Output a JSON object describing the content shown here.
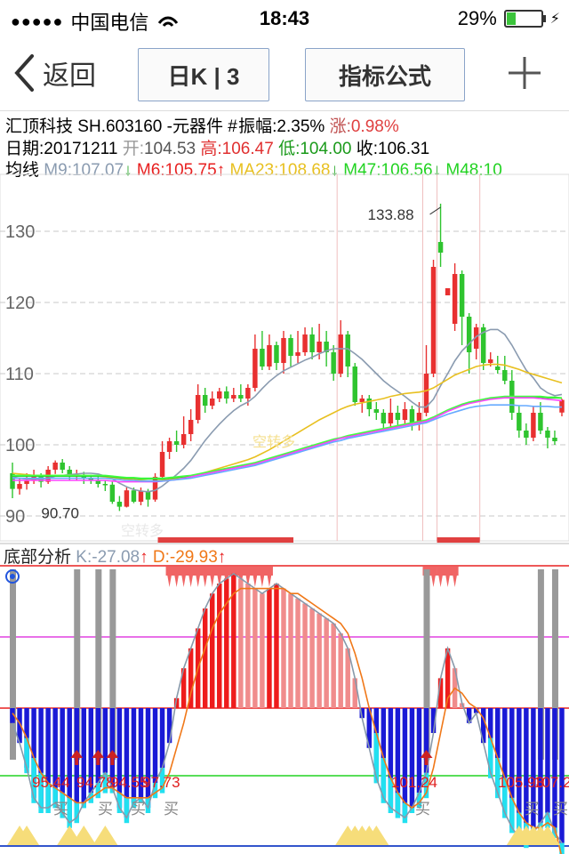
{
  "status": {
    "carrier": "中国电信",
    "time": "18:43",
    "battery_text": "29%",
    "battery_level": 0.29
  },
  "nav": {
    "back_label": "返回",
    "period_label": "日K | 3",
    "formula_label": "指标公式"
  },
  "info": {
    "name": "汇顶科技",
    "code": "SH.603160",
    "industry": "-元器件",
    "marker": "#",
    "amp_label": "振幅:",
    "amp": "2.35%",
    "chg_label": "涨:",
    "chg": "0.98%",
    "date_label": "日期:",
    "date": "20171211",
    "open_label": "开:",
    "open": "104.53",
    "high_label": "高:",
    "high": "106.47",
    "low_label": "低:",
    "low": "104.00",
    "close_label": "收:",
    "close": "106.31",
    "ma_label": "均线",
    "ma": [
      {
        "text": "M9:107.07",
        "arrow": "↓",
        "color": "#8a9bb0",
        "arrow_color": "#1aa31a"
      },
      {
        "text": "M6:105.75",
        "arrow": "↑",
        "color": "#e82020",
        "arrow_color": "#e82020"
      },
      {
        "text": "MA23:108.68",
        "arrow": "↓",
        "color": "#e8c020",
        "arrow_color": "#1aa31a"
      },
      {
        "text": "M47:106.56",
        "arrow": "↓",
        "color": "#22d322",
        "arrow_color": "#1aa31a"
      },
      {
        "text": "M48:10",
        "arrow": "",
        "color": "#22d322",
        "arrow_color": "#1aa31a"
      }
    ]
  },
  "main_chart": {
    "y_ticks": [
      "130",
      "120",
      "110",
      "100",
      "90"
    ],
    "max_label": "133.88",
    "min_label": "90.70",
    "faint_labels": [
      "空转多",
      "空转多"
    ]
  },
  "indicator": {
    "title": "底部分析",
    "k": "K:-27.08",
    "k_arrow": "↑",
    "d": "D:-29.93",
    "d_arrow": "↑",
    "value_labels": [
      "95.44",
      "94.78",
      "94.55",
      "97.73",
      "101.24",
      "105.93",
      "107.28"
    ],
    "buy_label": "买"
  },
  "chart_data": {
    "type": "candlestick",
    "ylim": [
      87,
      138
    ],
    "candles": [
      [
        96.0,
        93.8,
        97.5,
        92.5
      ],
      [
        93.8,
        94.5,
        95.2,
        93.0
      ],
      [
        94.5,
        95.0,
        96.0,
        93.7
      ],
      [
        95.0,
        95.5,
        96.5,
        94.5
      ],
      [
        95.5,
        94.8,
        96.0,
        94.0
      ],
      [
        94.8,
        96.5,
        97.0,
        94.5
      ],
      [
        96.5,
        97.5,
        97.8,
        95.9
      ],
      [
        97.5,
        96.5,
        98.0,
        96.0
      ],
      [
        96.5,
        95.6,
        97.0,
        95.0
      ],
      [
        95.6,
        95.8,
        96.5,
        95.0
      ],
      [
        95.8,
        95.3,
        96.2,
        94.5
      ],
      [
        95.3,
        95.0,
        95.8,
        94.5
      ],
      [
        95.0,
        94.5,
        95.5,
        94.0
      ],
      [
        94.5,
        94.4,
        95.0,
        93.5
      ],
      [
        94.4,
        92.0,
        94.8,
        91.7
      ],
      [
        92.0,
        91.3,
        92.8,
        90.7
      ],
      [
        91.3,
        93.6,
        94.0,
        91.2
      ],
      [
        93.6,
        92.0,
        94.0,
        91.8
      ],
      [
        92.0,
        93.5,
        94.0,
        91.5
      ],
      [
        93.5,
        92.3,
        93.8,
        91.3
      ],
      [
        92.3,
        95.5,
        96.0,
        92.0
      ],
      [
        95.5,
        99.0,
        100.5,
        95.3
      ],
      [
        99.0,
        100.5,
        101.0,
        98.0
      ],
      [
        100.5,
        100.0,
        102.0,
        99.0
      ],
      [
        100.0,
        101.5,
        104.0,
        99.5
      ],
      [
        101.5,
        103.5,
        105.0,
        100.5
      ],
      [
        103.5,
        107.0,
        108.5,
        103.0
      ],
      [
        107.0,
        105.5,
        108.0,
        104.5
      ],
      [
        105.5,
        106.5,
        107.5,
        105.0
      ],
      [
        106.5,
        107.5,
        108.0,
        106.0
      ],
      [
        107.5,
        106.5,
        108.2,
        105.8
      ],
      [
        106.5,
        107.0,
        108.0,
        106.0
      ],
      [
        107.0,
        106.5,
        108.5,
        106.0
      ],
      [
        106.5,
        108.0,
        108.5,
        105.5
      ],
      [
        108.0,
        113.5,
        115.5,
        107.5
      ],
      [
        113.5,
        111.0,
        116.0,
        110.5
      ],
      [
        111.0,
        114.0,
        115.5,
        110.5
      ],
      [
        114.0,
        111.5,
        114.5,
        110.5
      ],
      [
        111.5,
        115.0,
        116.0,
        110.0
      ],
      [
        115.0,
        112.5,
        115.5,
        111.0
      ],
      [
        112.5,
        113.0,
        116.0,
        111.5
      ],
      [
        113.0,
        115.5,
        116.5,
        112.5
      ],
      [
        115.5,
        113.0,
        116.5,
        112.0
      ],
      [
        113.0,
        114.5,
        117.0,
        112.0
      ],
      [
        114.5,
        113.0,
        116.0,
        111.0
      ],
      [
        113.0,
        110.0,
        114.0,
        109.0
      ],
      [
        110.0,
        115.5,
        117.5,
        109.5
      ],
      [
        115.5,
        111.0,
        116.0,
        109.5
      ],
      [
        111.0,
        106.0,
        111.5,
        105.5
      ],
      [
        106.0,
        106.5,
        107.0,
        104.5
      ],
      [
        106.5,
        105.0,
        107.0,
        104.0
      ],
      [
        105.0,
        104.5,
        106.0,
        103.5
      ],
      [
        104.5,
        103.0,
        105.0,
        102.0
      ],
      [
        103.0,
        104.5,
        106.5,
        102.5
      ],
      [
        104.5,
        103.5,
        105.5,
        102.5
      ],
      [
        103.5,
        105.0,
        106.0,
        103.0
      ],
      [
        105.0,
        103.0,
        105.5,
        102.0
      ],
      [
        103.0,
        104.5,
        106.0,
        102.0
      ],
      [
        104.5,
        110.0,
        114.0,
        104.0
      ],
      [
        110.0,
        125.0,
        126.0,
        109.5
      ],
      [
        128.5,
        127.0,
        133.88,
        125.0
      ],
      [
        121.0,
        122.0,
        122.0,
        121.0
      ],
      [
        117.0,
        124.0,
        125.5,
        116.0
      ],
      [
        124.0,
        118.0,
        124.5,
        114.0
      ],
      [
        118.0,
        113.0,
        118.5,
        110.0
      ],
      [
        113.5,
        116.5,
        117.0,
        112.0
      ],
      [
        116.5,
        111.5,
        117.0,
        110.5
      ],
      [
        111.5,
        112.0,
        113.0,
        111.0
      ],
      [
        111.0,
        110.5,
        112.5,
        110.0
      ],
      [
        110.5,
        109.0,
        112.5,
        108.5
      ],
      [
        109.0,
        104.5,
        110.5,
        103.5
      ],
      [
        104.5,
        102.0,
        105.5,
        101.0
      ],
      [
        102.0,
        101.0,
        103.0,
        100.0
      ],
      [
        101.0,
        104.5,
        105.5,
        100.5
      ],
      [
        104.5,
        102.0,
        106.0,
        101.5
      ],
      [
        102.0,
        101.0,
        102.5,
        99.5
      ],
      [
        101.0,
        100.5,
        102.0,
        100.0
      ],
      [
        104.53,
        106.31,
        106.47,
        104.0
      ]
    ],
    "ma": [
      {
        "name": "M9",
        "color": "#8a9bb0",
        "values": [
          95.5,
          95.3,
          95.2,
          95.2,
          95.2,
          95.3,
          95.6,
          95.7,
          95.8,
          95.9,
          96.0,
          96.0,
          95.9,
          95.6,
          95.2,
          94.6,
          94.1,
          93.7,
          93.5,
          93.4,
          93.6,
          94.2,
          95.0,
          95.8,
          96.7,
          97.8,
          99.2,
          100.6,
          101.8,
          102.9,
          103.9,
          104.8,
          105.5,
          106.0,
          106.8,
          107.9,
          108.9,
          109.7,
          110.4,
          110.9,
          111.4,
          111.9,
          112.3,
          112.8,
          113.2,
          113.5,
          113.5,
          113.5,
          112.8,
          112.0,
          111.0,
          110.0,
          109.0,
          108.2,
          107.5,
          106.8,
          106.0,
          105.3,
          105.3,
          106.4,
          108.3,
          110.0,
          111.8,
          113.2,
          114.2,
          115.2,
          115.8,
          116.2,
          116.2,
          115.5,
          114.0,
          112.2,
          110.5,
          109.4,
          108.0,
          107.3,
          106.9,
          107.07
        ]
      },
      {
        "name": "MA23",
        "color": "#e8c020",
        "values": [
          96.0,
          95.9,
          95.8,
          95.7,
          95.7,
          95.7,
          95.7,
          95.7,
          95.7,
          95.7,
          95.7,
          95.6,
          95.6,
          95.5,
          95.4,
          95.3,
          95.2,
          95.1,
          95.0,
          94.9,
          94.9,
          95.0,
          95.1,
          95.2,
          95.3,
          95.5,
          95.8,
          96.1,
          96.4,
          96.7,
          97.0,
          97.3,
          97.6,
          97.9,
          98.3,
          98.8,
          99.3,
          99.9,
          100.5,
          101.1,
          101.7,
          102.3,
          102.9,
          103.5,
          104.0,
          104.5,
          105.0,
          105.4,
          105.7,
          105.9,
          106.1,
          106.3,
          106.5,
          106.8,
          107.0,
          107.2,
          107.3,
          107.4,
          107.6,
          108.0,
          108.6,
          109.2,
          109.8,
          110.2,
          110.6,
          111.0,
          111.2,
          111.3,
          111.3,
          111.2,
          110.9,
          110.6,
          110.2,
          109.9,
          109.6,
          109.3,
          109.0,
          108.7
        ]
      },
      {
        "name": "M47",
        "color": "#22d322",
        "values": [
          95.6,
          95.6,
          95.6,
          95.6,
          95.6,
          95.6,
          95.6,
          95.6,
          95.6,
          95.6,
          95.6,
          95.6,
          95.6,
          95.6,
          95.5,
          95.4,
          95.3,
          95.3,
          95.2,
          95.2,
          95.2,
          95.2,
          95.3,
          95.4,
          95.5,
          95.6,
          95.8,
          96.0,
          96.2,
          96.4,
          96.6,
          96.8,
          97.0,
          97.2,
          97.4,
          97.7,
          98.0,
          98.3,
          98.6,
          98.9,
          99.2,
          99.5,
          99.8,
          100.1,
          100.4,
          100.7,
          100.9,
          101.2,
          101.4,
          101.6,
          101.8,
          102.0,
          102.2,
          102.4,
          102.6,
          102.8,
          103.0,
          103.2,
          103.4,
          103.8,
          104.3,
          104.8,
          105.2,
          105.6,
          105.9,
          106.1,
          106.3,
          106.5,
          106.6,
          106.7,
          106.7,
          106.7,
          106.7,
          106.7,
          106.7,
          106.6,
          106.6,
          106.56
        ]
      },
      {
        "name": "M48",
        "color": "#44ff44",
        "values": [
          95.7,
          95.7,
          95.7,
          95.7,
          95.7,
          95.7,
          95.7,
          95.7,
          95.7,
          95.7,
          95.7,
          95.7,
          95.7,
          95.7,
          95.6,
          95.5,
          95.4,
          95.4,
          95.3,
          95.3,
          95.3,
          95.3,
          95.4,
          95.5,
          95.6,
          95.7,
          95.9,
          96.1,
          96.3,
          96.5,
          96.7,
          96.9,
          97.1,
          97.3,
          97.5,
          97.8,
          98.1,
          98.4,
          98.7,
          99.0,
          99.3,
          99.6,
          99.9,
          100.2,
          100.5,
          100.8,
          101.0,
          101.3,
          101.5,
          101.7,
          101.9,
          102.1,
          102.3,
          102.5,
          102.7,
          102.9,
          103.1,
          103.3,
          103.5,
          103.9,
          104.4,
          104.9,
          105.3,
          105.7,
          106.0,
          106.2,
          106.4,
          106.6,
          106.7,
          106.8,
          106.8,
          106.8,
          106.8,
          106.8,
          106.8,
          106.7,
          106.7,
          106.6
        ]
      },
      {
        "name": "MAG",
        "color": "#ff44ff",
        "values": [
          95.0,
          95.0,
          95.0,
          95.0,
          95.0,
          95.0,
          95.0,
          95.0,
          95.0,
          95.0,
          95.0,
          95.0,
          95.0,
          95.0,
          94.9,
          94.8,
          94.8,
          94.8,
          94.8,
          94.8,
          94.8,
          94.9,
          95.0,
          95.1,
          95.3,
          95.5,
          95.7,
          95.9,
          96.1,
          96.3,
          96.5,
          96.7,
          96.9,
          97.1,
          97.3,
          97.6,
          97.9,
          98.2,
          98.5,
          98.8,
          99.1,
          99.4,
          99.7,
          100.0,
          100.3,
          100.6,
          100.9,
          101.1,
          101.3,
          101.5,
          101.7,
          101.9,
          102.1,
          102.3,
          102.5,
          102.7,
          102.9,
          103.1,
          103.3,
          103.7,
          104.2,
          104.7,
          105.1,
          105.5,
          105.8,
          106.0,
          106.2,
          106.4,
          106.5,
          106.6,
          106.6,
          106.6,
          106.6,
          106.6,
          106.5,
          106.4,
          106.3,
          106.2
        ]
      },
      {
        "name": "MAB",
        "color": "#66aaff",
        "values": [
          95.3,
          95.3,
          95.3,
          95.3,
          95.3,
          95.3,
          95.3,
          95.3,
          95.3,
          95.3,
          95.3,
          95.3,
          95.3,
          95.3,
          95.2,
          95.1,
          95.0,
          95.0,
          94.9,
          94.9,
          94.9,
          94.9,
          95.0,
          95.1,
          95.2,
          95.3,
          95.5,
          95.7,
          95.9,
          96.1,
          96.3,
          96.5,
          96.7,
          96.9,
          97.1,
          97.4,
          97.7,
          98.0,
          98.3,
          98.6,
          98.9,
          99.2,
          99.5,
          99.8,
          100.1,
          100.4,
          100.6,
          100.9,
          101.1,
          101.3,
          101.5,
          101.7,
          101.9,
          102.1,
          102.3,
          102.5,
          102.7,
          102.9,
          103.1,
          103.5,
          103.9,
          104.3,
          104.6,
          104.9,
          105.2,
          105.4,
          105.5,
          105.6,
          105.6,
          105.6,
          105.6,
          105.5,
          105.5,
          105.4,
          105.4,
          105.4,
          105.3,
          105.3
        ]
      }
    ],
    "indicator_bars": [
      -3,
      -7,
      -12,
      -18,
      -20,
      -20,
      -19,
      -21,
      -23,
      -22,
      -19,
      -17,
      -15,
      -13,
      -16,
      -20,
      -22,
      -19,
      -18,
      -20,
      -15,
      -12,
      -7,
      2,
      8,
      12,
      16,
      20,
      23,
      25,
      26,
      27,
      26,
      25,
      24,
      23,
      24,
      25,
      24,
      23,
      22,
      21,
      20,
      19,
      18,
      17,
      15,
      12,
      6,
      -2,
      -8,
      -14,
      -18,
      -20,
      -21,
      -22,
      -20,
      -17,
      -13,
      -5,
      6,
      12,
      8,
      1,
      -3,
      -1,
      -7,
      -13,
      -17,
      -21,
      -24,
      -26,
      -27,
      -25,
      -23,
      -21,
      -25,
      -27.08
    ],
    "indicator_k": [
      -3,
      -7,
      -12,
      -18,
      -20,
      -20,
      -19,
      -21,
      -23,
      -22,
      -19,
      -17,
      -15,
      -13,
      -16,
      -20,
      -22,
      -19,
      -18,
      -20,
      -15,
      -12,
      -7,
      2,
      8,
      12,
      16,
      20,
      23,
      25,
      26,
      27,
      26,
      25,
      24,
      23,
      24,
      25,
      24,
      23,
      22,
      21,
      20,
      19,
      18,
      17,
      15,
      12,
      6,
      -2,
      -8,
      -14,
      -18,
      -20,
      -21,
      -22,
      -20,
      -17,
      -13,
      -5,
      6,
      12,
      8,
      1,
      -3,
      -1,
      -7,
      -13,
      -17,
      -21,
      -24,
      -26,
      -27,
      -25,
      -23,
      -21,
      -25,
      -27.08
    ],
    "indicator_d": [
      -1,
      -3,
      -6,
      -10,
      -13,
      -15,
      -16,
      -17,
      -18,
      -19,
      -19,
      -18,
      -17,
      -16,
      -16,
      -17,
      -18,
      -18,
      -18,
      -18,
      -17,
      -16,
      -13,
      -8,
      -3,
      3,
      8,
      12,
      16,
      19,
      21,
      23,
      24,
      24,
      24,
      24,
      24,
      24,
      24,
      23,
      23,
      22,
      21,
      20,
      19,
      18,
      17,
      15,
      11,
      6,
      0,
      -5,
      -10,
      -14,
      -17,
      -19,
      -20,
      -19,
      -17,
      -12,
      -5,
      2,
      4,
      3,
      1,
      0,
      -2,
      -6,
      -10,
      -14,
      -18,
      -21,
      -23,
      -24,
      -24,
      -23,
      -24,
      -29.93
    ]
  }
}
